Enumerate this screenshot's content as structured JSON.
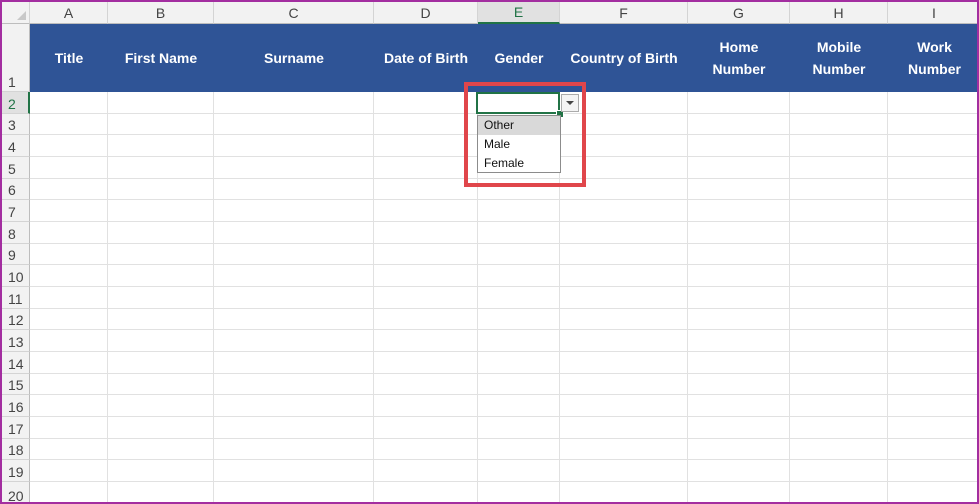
{
  "columns": [
    {
      "letter": "A",
      "header": "Title"
    },
    {
      "letter": "B",
      "header": "First Name"
    },
    {
      "letter": "C",
      "header": "Surname"
    },
    {
      "letter": "D",
      "header": "Date of Birth"
    },
    {
      "letter": "E",
      "header": "Gender"
    },
    {
      "letter": "F",
      "header": "Country of Birth"
    },
    {
      "letter": "G",
      "header": "Home\nNumber"
    },
    {
      "letter": "H",
      "header": "Mobile\nNumber"
    },
    {
      "letter": "I",
      "header": "Work\nNumber"
    }
  ],
  "rows": [
    "1",
    "2",
    "3",
    "4",
    "5",
    "6",
    "7",
    "8",
    "9",
    "10",
    "11",
    "12",
    "13",
    "14",
    "15",
    "16",
    "17",
    "18",
    "19",
    "20"
  ],
  "selection": {
    "column": "E",
    "row": "2"
  },
  "dropdown": {
    "options": [
      "Other",
      "Male",
      "Female"
    ],
    "highlighted": "Other"
  },
  "colors": {
    "header_fill": "#2f5496",
    "header_text": "#ffffff",
    "selection_green": "#217346",
    "callout_red": "#e0464b",
    "frame": "#a32ea0"
  }
}
